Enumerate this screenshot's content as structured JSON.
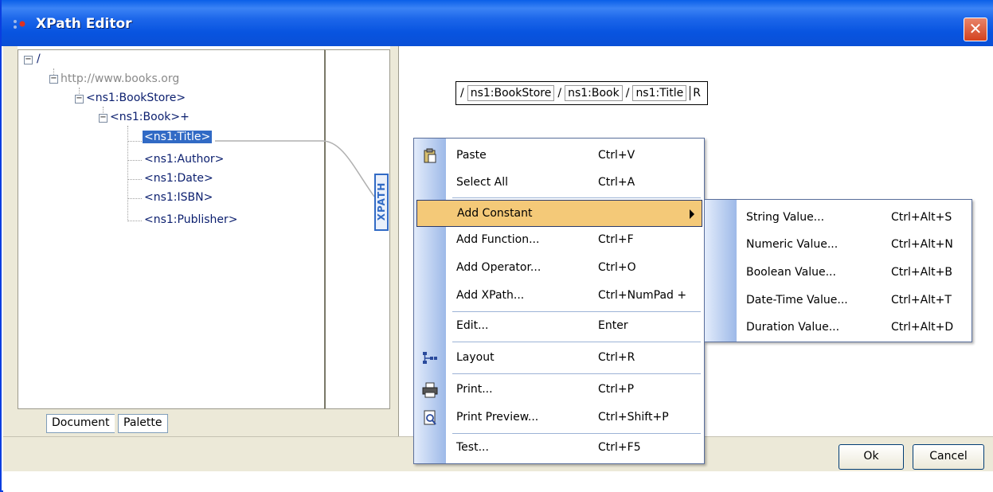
{
  "window": {
    "title": "XPath Editor"
  },
  "tree": {
    "nodes": [
      {
        "label": "/"
      },
      {
        "label": "http://www.books.org"
      },
      {
        "label": "<ns1:BookStore>"
      },
      {
        "label": "<ns1:Book>+"
      },
      {
        "label": "<ns1:Title>"
      },
      {
        "label": "<ns1:Author>"
      },
      {
        "label": "<ns1:Date>"
      },
      {
        "label": "<ns1:ISBN>"
      },
      {
        "label": "<ns1:Publisher>"
      }
    ],
    "selected": "<ns1:Title>"
  },
  "tabs": {
    "document": "Document",
    "palette": "Palette"
  },
  "xpath_label": "XPATH",
  "path": {
    "slash": "/",
    "segments": [
      "ns1:BookStore",
      "ns1:Book",
      "ns1:Title"
    ],
    "trailing": "R"
  },
  "context_menu": {
    "items": [
      {
        "label": "Paste",
        "shortcut": "Ctrl+V",
        "icon": "paste-icon"
      },
      {
        "label": "Select All",
        "shortcut": "Ctrl+A"
      },
      {
        "label": "Add Constant",
        "shortcut": "",
        "submenu": true
      },
      {
        "label": "Add Function...",
        "shortcut": "Ctrl+F"
      },
      {
        "label": "Add Operator...",
        "shortcut": "Ctrl+O"
      },
      {
        "label": "Add XPath...",
        "shortcut": "Ctrl+NumPad +"
      },
      {
        "label": "Edit...",
        "shortcut": "Enter"
      },
      {
        "label": "Layout",
        "shortcut": "Ctrl+R",
        "icon": "layout-icon"
      },
      {
        "label": "Print...",
        "shortcut": "Ctrl+P",
        "icon": "printer-icon"
      },
      {
        "label": "Print Preview...",
        "shortcut": "Ctrl+Shift+P",
        "icon": "print-preview-icon"
      },
      {
        "label": "Test...",
        "shortcut": "Ctrl+F5"
      }
    ],
    "highlighted": "Add Constant"
  },
  "submenu": {
    "items": [
      {
        "label": "String Value...",
        "shortcut": "Ctrl+Alt+S"
      },
      {
        "label": "Numeric Value...",
        "shortcut": "Ctrl+Alt+N"
      },
      {
        "label": "Boolean Value...",
        "shortcut": "Ctrl+Alt+B"
      },
      {
        "label": "Date-Time Value...",
        "shortcut": "Ctrl+Alt+T"
      },
      {
        "label": "Duration Value...",
        "shortcut": "Ctrl+Alt+D"
      }
    ]
  },
  "buttons": {
    "ok": "Ok",
    "cancel": "Cancel"
  },
  "colors": {
    "titlebar": "#0a5fe8",
    "selection": "#316ac5",
    "menu_highlight": "#f4c978"
  }
}
